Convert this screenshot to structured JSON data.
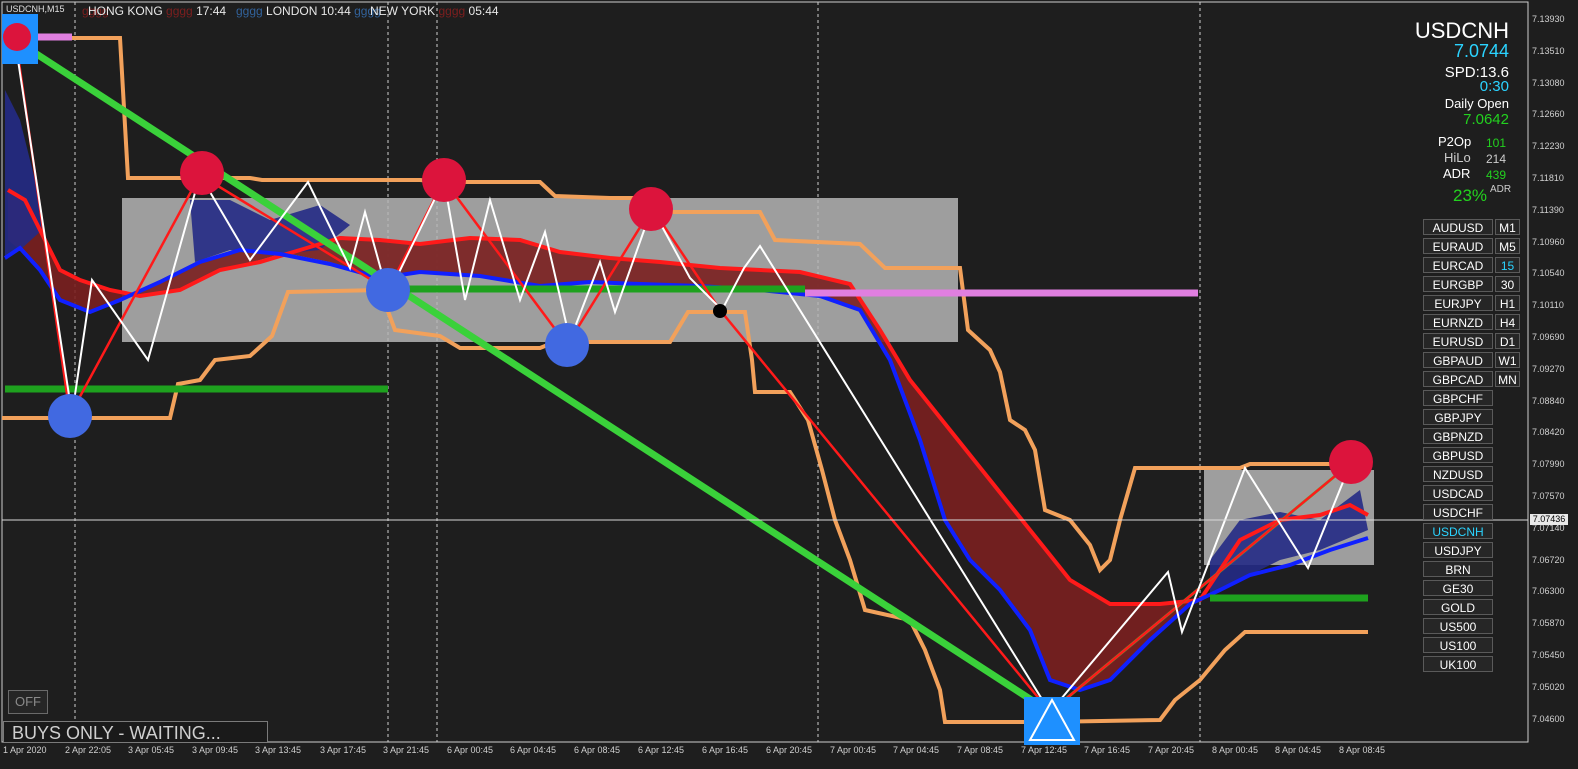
{
  "chart_title": "USDCNH,M15",
  "sessions": {
    "hong_kong": {
      "label": "HONG KONG",
      "time": "17:44"
    },
    "london": {
      "label": "LONDON",
      "time": "10:44"
    },
    "new_york": {
      "label": "NEW YORK",
      "time": "05:44"
    },
    "ghost_text": "gggg"
  },
  "panel": {
    "symbol": "USDCNH",
    "price": "7.0744",
    "spread_label": "SPD:13.6",
    "timer": "0:30",
    "daily_open_label": "Daily Open",
    "daily_open_value": "7.0642",
    "p2op_label": "P2Op",
    "p2op_value": "101",
    "hilo_label": "HiLo",
    "hilo_value": "214",
    "adr_label": "ADR",
    "adr_value": "439",
    "adr_pct": "23%",
    "adr_badge": "ADR",
    "colors": {
      "price": "#2bd3ff",
      "green": "#23d11f",
      "gray": "#cccccc"
    }
  },
  "symbols": [
    "AUDUSD",
    "EURAUD",
    "EURCAD",
    "EURGBP",
    "EURJPY",
    "EURNZD",
    "EURUSD",
    "GBPAUD",
    "GBPCAD",
    "GBPCHF",
    "GBPJPY",
    "GBPNZD",
    "GBPUSD",
    "NZDUSD",
    "USDCAD",
    "USDCHF",
    "USDCNH",
    "USDJPY",
    "BRN",
    "GE30",
    "GOLD",
    "US500",
    "US100",
    "UK100"
  ],
  "active_symbol": "USDCNH",
  "timeframes": [
    "M1",
    "M5",
    "15",
    "30",
    "H1",
    "H4",
    "D1",
    "W1",
    "MN"
  ],
  "active_timeframe": "15",
  "y_axis": [
    "7.13930",
    "7.13510",
    "7.13080",
    "7.12660",
    "7.12230",
    "7.11810",
    "7.11390",
    "7.10960",
    "7.10540",
    "7.10110",
    "7.09690",
    "7.09270",
    "7.08840",
    "7.08420",
    "7.07990",
    "7.07570",
    "7.07140",
    "7.06720",
    "7.06300",
    "7.05870",
    "7.05450",
    "7.05020",
    "7.04600"
  ],
  "current_price_tag": "7.07436",
  "x_axis": [
    "1 Apr 2020",
    "2 Apr 22:05",
    "3 Apr 05:45",
    "3 Apr 09:45",
    "3 Apr 13:45",
    "3 Apr 17:45",
    "3 Apr 21:45",
    "6 Apr 00:45",
    "6 Apr 04:45",
    "6 Apr 08:45",
    "6 Apr 12:45",
    "6 Apr 16:45",
    "6 Apr 20:45",
    "7 Apr 00:45",
    "7 Apr 04:45",
    "7 Apr 08:45",
    "7 Apr 12:45",
    "7 Apr 16:45",
    "7 Apr 20:45",
    "8 Apr 00:45",
    "8 Apr 04:45",
    "8 Apr 08:45"
  ],
  "off_button": "OFF",
  "status": "BUYS ONLY - WAITING...",
  "chart_data": {
    "type": "line",
    "title": "USDCNH,M15",
    "ylim": [
      7.046,
      7.1393
    ],
    "x": [
      "1 Apr 2020",
      "2 Apr 22:05",
      "3 Apr 05:45",
      "3 Apr 09:45",
      "3 Apr 13:45",
      "3 Apr 17:45",
      "3 Apr 21:45",
      "6 Apr 00:45",
      "6 Apr 04:45",
      "6 Apr 08:45",
      "6 Apr 12:45",
      "6 Apr 16:45",
      "6 Apr 20:45",
      "7 Apr 00:45",
      "7 Apr 04:45",
      "7 Apr 08:45",
      "7 Apr 12:45",
      "7 Apr 16:45",
      "7 Apr 20:45",
      "8 Apr 00:45",
      "8 Apr 04:45",
      "8 Apr 08:45"
    ],
    "series": [
      {
        "values": [
          7.128,
          7.094,
          7.106,
          7.112,
          7.111,
          7.109,
          7.108,
          7.109,
          7.106,
          7.107,
          7.108,
          7.107,
          7.106,
          7.104,
          7.096,
          7.081,
          7.057,
          7.064,
          7.065,
          7.072,
          7.073,
          7.075
        ]
      }
    ],
    "current_price": 7.07436,
    "grid": false
  }
}
